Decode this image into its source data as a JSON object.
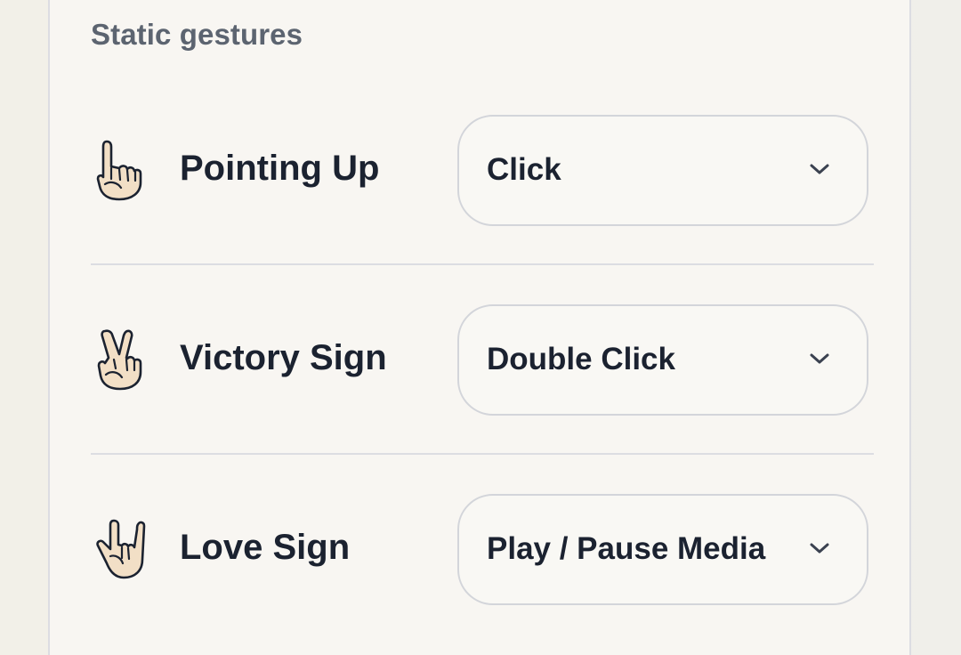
{
  "section": {
    "title": "Static gestures"
  },
  "gestures": [
    {
      "label": "Pointing Up",
      "icon": "pointing-up-hand-icon",
      "action": "Click"
    },
    {
      "label": "Victory Sign",
      "icon": "victory-hand-icon",
      "action": "Double Click"
    },
    {
      "label": "Love Sign",
      "icon": "love-you-hand-icon",
      "action": "Play / Pause Media"
    }
  ],
  "colors": {
    "background": "#f2f0e8",
    "panel": "#f8f6f2",
    "text": "#1b2230",
    "muted": "#5c6470",
    "border": "#d3d5da",
    "skin": "#f2dfc6"
  }
}
